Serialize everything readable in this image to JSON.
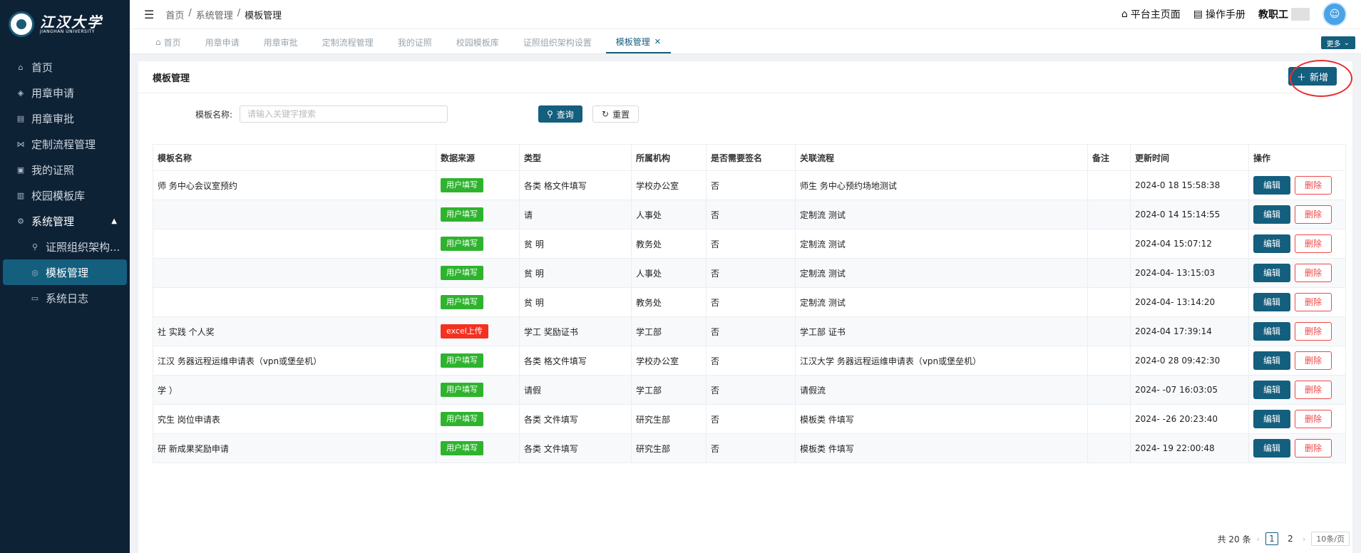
{
  "logo": {
    "cn": "江汉大学",
    "en": "JIANGHAN UNIVERSITY"
  },
  "sidebar": {
    "items": [
      {
        "label": "首页",
        "icon": "home-icon"
      },
      {
        "label": "用章申请",
        "icon": "stamp-icon"
      },
      {
        "label": "用章审批",
        "icon": "document-icon"
      },
      {
        "label": "定制流程管理",
        "icon": "flow-icon"
      },
      {
        "label": "我的证照",
        "icon": "certificate-icon"
      },
      {
        "label": "校园模板库",
        "icon": "template-icon"
      },
      {
        "label": "系统管理",
        "icon": "gear-icon"
      },
      {
        "label": "证照组织架构...",
        "icon": "org-icon"
      },
      {
        "label": "模板管理",
        "icon": "template-manage-icon"
      },
      {
        "label": "系统日志",
        "icon": "log-icon"
      }
    ]
  },
  "header": {
    "breadcrumb": [
      "首页",
      "系统管理",
      "模板管理"
    ],
    "separator": "/",
    "platform_home": "平台主页面",
    "manual": "操作手册",
    "user_role": "教职工"
  },
  "tabs": {
    "items": [
      "首页",
      "用章申请",
      "用章审批",
      "定制流程管理",
      "我的证照",
      "校园模板库",
      "证照组织架构设置",
      "模板管理"
    ],
    "more": "更多"
  },
  "main": {
    "title": "模板管理",
    "add_label": "新增",
    "search_label": "模板名称:",
    "search_placeholder": "请输入关键字搜索",
    "query_label": "查询",
    "reset_label": "重置"
  },
  "table": {
    "columns": [
      "模板名称",
      "数据来源",
      "类型",
      "所属机构",
      "是否需要签名",
      "关联流程",
      "备注",
      "更新时间",
      "操作"
    ],
    "edit_label": "编辑",
    "delete_label": "删除",
    "rows": [
      {
        "name": "师 务中心会议室预约",
        "source": "用户填写",
        "source_color": "#2fb32f",
        "type": "各类 格文件填写",
        "org": "学校办公室",
        "sign": "否",
        "flow": "师生 务中心预约场地测试",
        "remark": "",
        "time": "2024-0 18 15:58:38"
      },
      {
        "name": "",
        "source": "用户填写",
        "source_color": "#2fb32f",
        "type": "请",
        "org": "人事处",
        "sign": "否",
        "flow": "定制流 测试",
        "remark": "",
        "time": "2024-0 14 15:14:55"
      },
      {
        "name": "",
        "source": "用户填写",
        "source_color": "#2fb32f",
        "type": "贫 明",
        "org": "教务处",
        "sign": "否",
        "flow": "定制流 测试",
        "remark": "",
        "time": "2024-04 15:07:12"
      },
      {
        "name": "",
        "source": "用户填写",
        "source_color": "#2fb32f",
        "type": "贫 明",
        "org": "人事处",
        "sign": "否",
        "flow": "定制流 测试",
        "remark": "",
        "time": "2024-04- 13:15:03"
      },
      {
        "name": "",
        "source": "用户填写",
        "source_color": "#2fb32f",
        "type": "贫 明",
        "org": "教务处",
        "sign": "否",
        "flow": "定制流 测试",
        "remark": "",
        "time": "2024-04- 13:14:20"
      },
      {
        "name": "社 实践 个人奖",
        "source": "excel上传",
        "source_color": "#f53020",
        "type": "学工 奖励证书",
        "org": "学工部",
        "sign": "否",
        "flow": "学工部 证书",
        "remark": "",
        "time": "2024-04 17:39:14"
      },
      {
        "name": "江汉 务器远程运维申请表（vpn或堡垒机）",
        "source": "用户填写",
        "source_color": "#2fb32f",
        "type": "各类 格文件填写",
        "org": "学校办公室",
        "sign": "否",
        "flow": "江汉大学 务器远程运维申请表（vpn或堡垒机）",
        "remark": "",
        "time": "2024-0 28 09:42:30"
      },
      {
        "name": "学 ）",
        "source": "用户填写",
        "source_color": "#2fb32f",
        "type": "请假",
        "org": "学工部",
        "sign": "否",
        "flow": "请假流",
        "remark": "",
        "time": "2024- -07 16:03:05"
      },
      {
        "name": "究生 岗位申请表",
        "source": "用户填写",
        "source_color": "#2fb32f",
        "type": "各类 文件填写",
        "org": "研究生部",
        "sign": "否",
        "flow": "模板类 件填写",
        "remark": "",
        "time": "2024- -26 20:23:40"
      },
      {
        "name": "研 新成果奖励申请",
        "source": "用户填写",
        "source_color": "#2fb32f",
        "type": "各类 文件填写",
        "org": "研究生部",
        "sign": "否",
        "flow": "模板类 件填写",
        "remark": "",
        "time": "2024- 19 22:00:48"
      }
    ]
  },
  "pager": {
    "total": "共 20 条",
    "pages": [
      "1",
      "2"
    ],
    "page_size": "10条/页"
  }
}
